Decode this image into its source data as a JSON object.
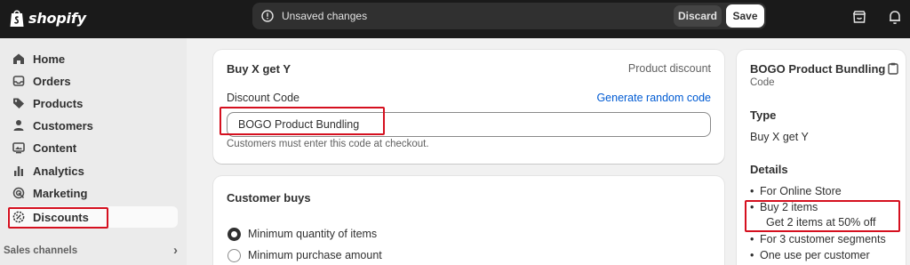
{
  "topbar": {
    "logo_text": "shopify",
    "unsaved_label": "Unsaved changes",
    "discard_label": "Discard",
    "save_label": "Save"
  },
  "sidebar": {
    "items": [
      {
        "label": "Home",
        "icon": "home-icon"
      },
      {
        "label": "Orders",
        "icon": "inbox-icon"
      },
      {
        "label": "Products",
        "icon": "tag-icon"
      },
      {
        "label": "Customers",
        "icon": "person-icon"
      },
      {
        "label": "Content",
        "icon": "image-icon"
      },
      {
        "label": "Analytics",
        "icon": "bar-chart-icon"
      },
      {
        "label": "Marketing",
        "icon": "target-icon"
      },
      {
        "label": "Discounts",
        "icon": "discount-gear-icon",
        "active": true
      }
    ],
    "sales_channels_label": "Sales channels",
    "sales_channels_chevron": "›"
  },
  "discount_card": {
    "title": "Buy X get Y",
    "type_label": "Product discount",
    "code_label": "Discount Code",
    "generate_link": "Generate random code",
    "code_value": "BOGO Product Bundling",
    "help_text": "Customers must enter this code at checkout."
  },
  "customer_buys_card": {
    "title": "Customer buys",
    "options": [
      {
        "label": "Minimum quantity of items",
        "selected": true
      },
      {
        "label": "Minimum purchase amount",
        "selected": false
      }
    ]
  },
  "summary": {
    "title": "BOGO Product Bundling",
    "subtitle": "Code",
    "type_heading": "Type",
    "type_value": "Buy X get Y",
    "details_heading": "Details",
    "details": [
      "For Online Store",
      "Buy 2 items",
      "Get 2 items at 50% off",
      "For 3 customer segments",
      "One use per customer"
    ]
  },
  "colors": {
    "accent_link": "#005bd3",
    "highlight": "#d5101f",
    "topbar_bg": "#1a1a1a"
  }
}
